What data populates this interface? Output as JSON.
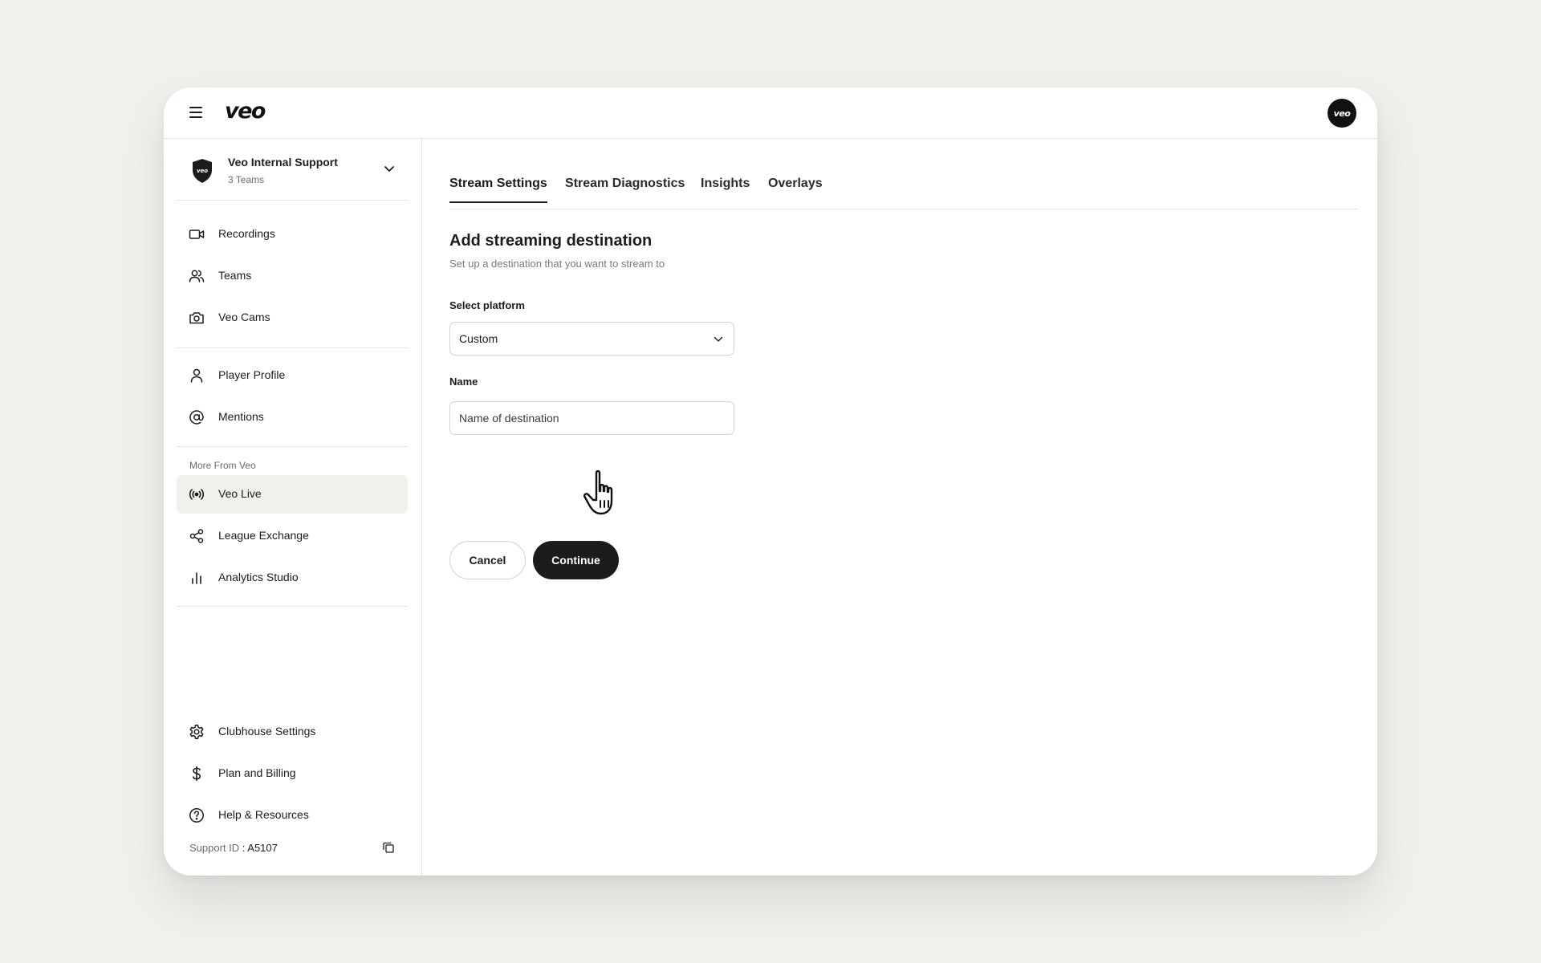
{
  "header": {
    "logo_text": "veo",
    "avatar_text": "veo"
  },
  "org": {
    "name": "Veo Internal Support",
    "teams": "3 Teams"
  },
  "nav_primary": [
    {
      "label": "Recordings",
      "icon": "video-camera-icon"
    },
    {
      "label": "Teams",
      "icon": "users-icon"
    },
    {
      "label": "Veo Cams",
      "icon": "camera-icon"
    }
  ],
  "nav_secondary": [
    {
      "label": "Player Profile",
      "icon": "user-icon"
    },
    {
      "label": "Mentions",
      "icon": "at-sign-icon"
    }
  ],
  "more_section": {
    "label": "More From Veo",
    "items": [
      {
        "label": "Veo Live",
        "icon": "broadcast-icon",
        "active": true
      },
      {
        "label": "League Exchange",
        "icon": "share-icon"
      },
      {
        "label": "Analytics Studio",
        "icon": "bar-chart-icon"
      }
    ]
  },
  "nav_bottom": [
    {
      "label": "Clubhouse Settings",
      "icon": "gear-icon"
    },
    {
      "label": "Plan and Billing",
      "icon": "dollar-icon"
    },
    {
      "label": "Help & Resources",
      "icon": "help-circle-icon"
    }
  ],
  "support": {
    "label": "Support ID",
    "separator": " : ",
    "value": "A5107"
  },
  "tabs": [
    {
      "label": "Stream Settings",
      "active": true
    },
    {
      "label": "Stream Diagnostics"
    },
    {
      "label": "Insights"
    },
    {
      "label": "Overlays"
    }
  ],
  "form": {
    "title": "Add streaming destination",
    "subtitle": "Set up a destination that you want to stream to",
    "platform_label": "Select platform",
    "platform_value": "Custom",
    "name_label": "Name",
    "name_placeholder": "Name of destination",
    "name_value": "",
    "cancel_label": "Cancel",
    "continue_label": "Continue"
  },
  "colors": {
    "background": "#f1f0ec",
    "primary_button": "#1c1d1a",
    "active_nav": "#f1f0ec"
  }
}
